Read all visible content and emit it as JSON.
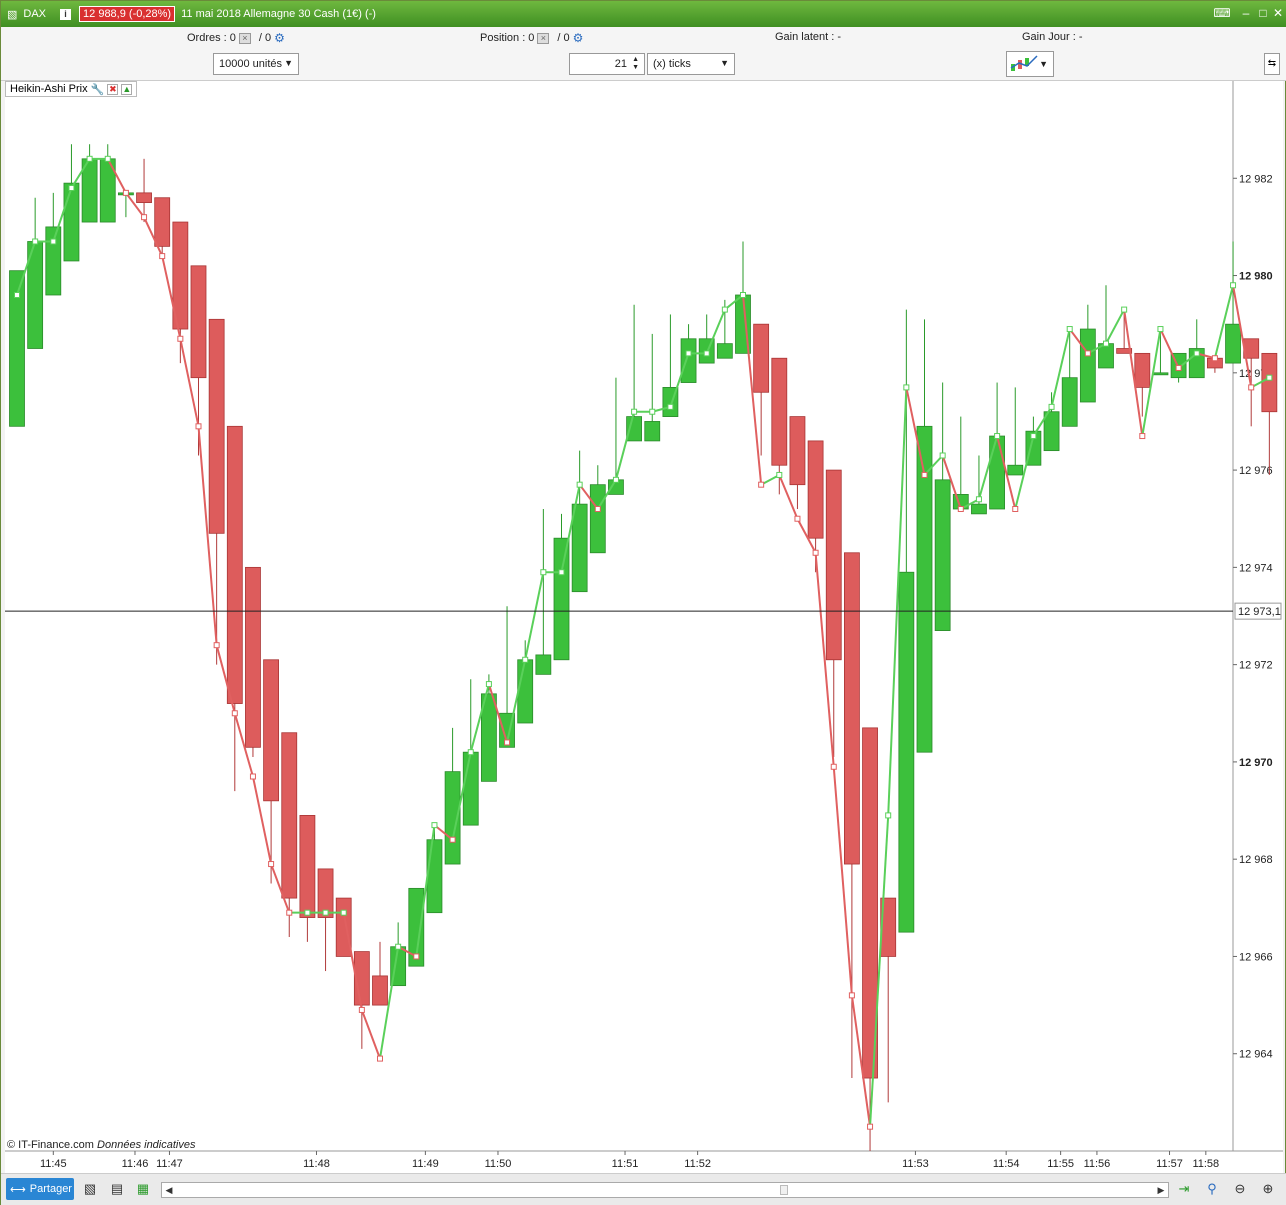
{
  "titlebar": {
    "symbol": "DAX",
    "info_icon": "info-icon",
    "price_badge": "12 988,9 (-0,28%)",
    "title": "11 mai 2018 Allemagne 30 Cash (1€) (-)"
  },
  "orders_row": {
    "ordres_label": "Ordres :",
    "ordres_value": "0",
    "ordres_slash": "/ 0",
    "position_label": "Position :",
    "position_value": "0",
    "position_slash": "/ 0",
    "gain_latent_label": "Gain latent :",
    "gain_latent_value": "-",
    "gain_jour_label": "Gain Jour :",
    "gain_jour_value": "-"
  },
  "controls": {
    "quantity": "10000 unités",
    "ticks_value": "21",
    "ticks_unit": "(x) ticks"
  },
  "indicator": {
    "label": "Heikin-Ashi Prix"
  },
  "copyright": {
    "owner": "© IT-Finance.com",
    "note": "Données indicatives"
  },
  "bottombar": {
    "share_label": "Partager"
  },
  "colors": {
    "bull": "#3cc03c",
    "bear": "#dd5c5c",
    "bull_line": "#5ad05a",
    "bear_line": "#e06060"
  },
  "chart_data": {
    "type": "candlestick",
    "style": "Heikin-Ashi",
    "ylim": [
      12962,
      12984
    ],
    "yticks": [
      "12 964",
      "12 966",
      "12 968",
      "12 970",
      "12 972",
      "12 974",
      "12 976",
      "12 978",
      "12 980",
      "12 982"
    ],
    "ytick_values": [
      12964,
      12966,
      12968,
      12970,
      12972,
      12974,
      12976,
      12978,
      12980,
      12982
    ],
    "bold_yticks": [
      "12 970",
      "12 980"
    ],
    "crosshair_value": 12973.1,
    "crosshair_label": "12 973,1",
    "xticks": [
      {
        "index": 2,
        "label": "11:45"
      },
      {
        "index": 6.5,
        "label": "11:46"
      },
      {
        "index": 8.4,
        "label": "11:47"
      },
      {
        "index": 16.5,
        "label": "11:48"
      },
      {
        "index": 22.5,
        "label": "11:49"
      },
      {
        "index": 26.5,
        "label": "11:50"
      },
      {
        "index": 33.5,
        "label": "11:51"
      },
      {
        "index": 37.5,
        "label": "11:52"
      },
      {
        "index": 49.5,
        "label": "11:53"
      },
      {
        "index": 54.5,
        "label": "11:54"
      },
      {
        "index": 57.5,
        "label": "11:55"
      },
      {
        "index": 59.5,
        "label": "11:56"
      },
      {
        "index": 63.5,
        "label": "11:57"
      },
      {
        "index": 65.5,
        "label": "11:58"
      }
    ],
    "candles": [
      {
        "o": 12976.9,
        "h": 12980.0,
        "l": 12976.9,
        "c": 12980.1,
        "p": 12979.6
      },
      {
        "o": 12978.5,
        "h": 12981.6,
        "l": 12978.5,
        "c": 12980.7,
        "p": 12980.7
      },
      {
        "o": 12979.6,
        "h": 12981.7,
        "l": 12979.6,
        "c": 12981.0,
        "p": 12980.7
      },
      {
        "o": 12980.3,
        "h": 12982.7,
        "l": 12980.3,
        "c": 12981.9,
        "p": 12981.8
      },
      {
        "o": 12981.1,
        "h": 12982.7,
        "l": 12981.1,
        "c": 12982.4,
        "p": 12982.4
      },
      {
        "o": 12981.1,
        "h": 12982.7,
        "l": 12981.1,
        "c": 12982.4,
        "p": 12982.4
      },
      {
        "o": 12981.7,
        "h": 12981.7,
        "l": 12981.2,
        "c": 12981.7,
        "p": 12981.7
      },
      {
        "o": 12981.7,
        "h": 12982.4,
        "l": 12981.1,
        "c": 12981.5,
        "p": 12981.2
      },
      {
        "o": 12981.6,
        "h": 12981.6,
        "l": 12980.4,
        "c": 12980.6,
        "p": 12980.4
      },
      {
        "o": 12981.1,
        "h": 12981.1,
        "l": 12978.2,
        "c": 12978.9,
        "p": 12978.7
      },
      {
        "o": 12980.2,
        "h": 12980.2,
        "l": 12976.3,
        "c": 12977.9,
        "p": 12976.9
      },
      {
        "o": 12979.1,
        "h": 12979.1,
        "l": 12972.0,
        "c": 12974.7,
        "p": 12972.4
      },
      {
        "o": 12976.9,
        "h": 12976.9,
        "l": 12969.4,
        "c": 12971.2,
        "p": 12971.0
      },
      {
        "o": 12974.0,
        "h": 12974.0,
        "l": 12970.1,
        "c": 12970.3,
        "p": 12969.7
      },
      {
        "o": 12972.1,
        "h": 12972.1,
        "l": 12967.5,
        "c": 12969.2,
        "p": 12967.9
      },
      {
        "o": 12970.6,
        "h": 12970.6,
        "l": 12966.4,
        "c": 12967.2,
        "p": 12966.9
      },
      {
        "o": 12968.9,
        "h": 12968.9,
        "l": 12966.3,
        "c": 12966.8,
        "p": 12966.9
      },
      {
        "o": 12967.8,
        "h": 12967.8,
        "l": 12965.7,
        "c": 12966.8,
        "p": 12966.9
      },
      {
        "o": 12967.2,
        "h": 12967.2,
        "l": 12966.0,
        "c": 12966.0,
        "p": 12966.9
      },
      {
        "o": 12966.1,
        "h": 12966.1,
        "l": 12964.1,
        "c": 12965.0,
        "p": 12964.9
      },
      {
        "o": 12965.6,
        "h": 12966.3,
        "l": 12965.0,
        "c": 12965.0,
        "p": 12963.9
      },
      {
        "o": 12965.4,
        "h": 12966.7,
        "l": 12965.4,
        "c": 12966.2,
        "p": 12966.2
      },
      {
        "o": 12965.8,
        "h": 12967.1,
        "l": 12965.8,
        "c": 12967.4,
        "p": 12966.0
      },
      {
        "o": 12966.9,
        "h": 12968.7,
        "l": 12966.9,
        "c": 12968.4,
        "p": 12968.7
      },
      {
        "o": 12967.9,
        "h": 12970.7,
        "l": 12967.9,
        "c": 12969.8,
        "p": 12968.4
      },
      {
        "o": 12968.7,
        "h": 12971.7,
        "l": 12968.7,
        "c": 12970.2,
        "p": 12970.2
      },
      {
        "o": 12969.6,
        "h": 12971.8,
        "l": 12969.6,
        "c": 12971.4,
        "p": 12971.6
      },
      {
        "o": 12970.3,
        "h": 12973.2,
        "l": 12970.3,
        "c": 12971.0,
        "p": 12970.4
      },
      {
        "o": 12970.8,
        "h": 12972.5,
        "l": 12970.8,
        "c": 12972.1,
        "p": 12972.1
      },
      {
        "o": 12971.8,
        "h": 12975.2,
        "l": 12971.8,
        "c": 12972.2,
        "p": 12973.9
      },
      {
        "o": 12972.1,
        "h": 12975.1,
        "l": 12972.1,
        "c": 12974.6,
        "p": 12973.9
      },
      {
        "o": 12973.5,
        "h": 12976.4,
        "l": 12973.5,
        "c": 12975.3,
        "p": 12975.7
      },
      {
        "o": 12974.3,
        "h": 12976.1,
        "l": 12974.3,
        "c": 12975.7,
        "p": 12975.2
      },
      {
        "o": 12975.5,
        "h": 12977.9,
        "l": 12975.5,
        "c": 12975.8,
        "p": 12975.8
      },
      {
        "o": 12976.6,
        "h": 12979.4,
        "l": 12976.6,
        "c": 12977.1,
        "p": 12977.2
      },
      {
        "o": 12976.6,
        "h": 12978.8,
        "l": 12976.6,
        "c": 12977.0,
        "p": 12977.2
      },
      {
        "o": 12977.1,
        "h": 12979.2,
        "l": 12977.1,
        "c": 12977.7,
        "p": 12977.3
      },
      {
        "o": 12977.8,
        "h": 12979.0,
        "l": 12977.8,
        "c": 12978.7,
        "p": 12978.4
      },
      {
        "o": 12978.2,
        "h": 12979.2,
        "l": 12978.2,
        "c": 12978.7,
        "p": 12978.4
      },
      {
        "o": 12978.3,
        "h": 12979.5,
        "l": 12978.3,
        "c": 12978.6,
        "p": 12979.3
      },
      {
        "o": 12978.4,
        "h": 12980.7,
        "l": 12978.4,
        "c": 12979.6,
        "p": 12979.6
      },
      {
        "o": 12979.0,
        "h": 12979.0,
        "l": 12976.3,
        "c": 12977.6,
        "p": 12975.7
      },
      {
        "o": 12978.3,
        "h": 12978.3,
        "l": 12975.5,
        "c": 12976.1,
        "p": 12975.9
      },
      {
        "o": 12977.1,
        "h": 12977.1,
        "l": 12975.2,
        "c": 12975.7,
        "p": 12975.0
      },
      {
        "o": 12976.6,
        "h": 12976.6,
        "l": 12973.9,
        "c": 12974.6,
        "p": 12974.3
      },
      {
        "o": 12976.0,
        "h": 12976.0,
        "l": 12970.1,
        "c": 12972.1,
        "p": 12969.9
      },
      {
        "o": 12974.3,
        "h": 12974.3,
        "l": 12963.5,
        "c": 12967.9,
        "p": 12965.2
      },
      {
        "o": 12970.7,
        "h": 12970.7,
        "l": 12962.0,
        "c": 12963.5,
        "p": 12962.5
      },
      {
        "o": 12967.2,
        "h": 12967.2,
        "l": 12963.0,
        "c": 12966.0,
        "p": 12968.9
      },
      {
        "o": 12966.5,
        "h": 12979.3,
        "l": 12966.5,
        "c": 12973.9,
        "p": 12977.7
      },
      {
        "o": 12970.2,
        "h": 12979.1,
        "l": 12970.2,
        "c": 12976.9,
        "p": 12975.9
      },
      {
        "o": 12972.7,
        "h": 12977.8,
        "l": 12972.7,
        "c": 12975.8,
        "p": 12976.3
      },
      {
        "o": 12975.2,
        "h": 12977.1,
        "l": 12975.2,
        "c": 12975.5,
        "p": 12975.2
      },
      {
        "o": 12975.1,
        "h": 12976.3,
        "l": 12975.1,
        "c": 12975.3,
        "p": 12975.4
      },
      {
        "o": 12975.2,
        "h": 12977.8,
        "l": 12975.2,
        "c": 12976.7,
        "p": 12976.7
      },
      {
        "o": 12975.9,
        "h": 12977.7,
        "l": 12975.9,
        "c": 12976.1,
        "p": 12975.2
      },
      {
        "o": 12976.1,
        "h": 12977.1,
        "l": 12976.1,
        "c": 12976.8,
        "p": 12976.7
      },
      {
        "o": 12976.4,
        "h": 12977.6,
        "l": 12976.4,
        "c": 12977.2,
        "p": 12977.3
      },
      {
        "o": 12976.9,
        "h": 12978.9,
        "l": 12976.9,
        "c": 12977.9,
        "p": 12978.9
      },
      {
        "o": 12977.4,
        "h": 12979.4,
        "l": 12977.4,
        "c": 12978.9,
        "p": 12978.4
      },
      {
        "o": 12978.1,
        "h": 12979.8,
        "l": 12978.1,
        "c": 12978.6,
        "p": 12978.6
      },
      {
        "o": 12978.5,
        "h": 12979.3,
        "l": 12978.5,
        "c": 12978.4,
        "p": 12979.3
      },
      {
        "o": 12978.4,
        "h": 12978.4,
        "l": 12977.1,
        "c": 12977.7,
        "p": 12976.7
      },
      {
        "o": 12978.0,
        "h": 12978.9,
        "l": 12978.0,
        "c": 12978.0,
        "p": 12978.9
      },
      {
        "o": 12977.9,
        "h": 12978.4,
        "l": 12977.8,
        "c": 12978.4,
        "p": 12978.1
      },
      {
        "o": 12977.9,
        "h": 12979.1,
        "l": 12977.9,
        "c": 12978.5,
        "p": 12978.4
      },
      {
        "o": 12978.3,
        "h": 12978.3,
        "l": 12978.0,
        "c": 12978.1,
        "p": 12978.3
      },
      {
        "o": 12978.2,
        "h": 12980.7,
        "l": 12978.2,
        "c": 12979.0,
        "p": 12979.8
      },
      {
        "o": 12978.7,
        "h": 12978.7,
        "l": 12976.9,
        "c": 12978.3,
        "p": 12977.7
      },
      {
        "o": 12978.4,
        "h": 12978.4,
        "l": 12975.9,
        "c": 12977.2,
        "p": 12977.9
      }
    ]
  }
}
